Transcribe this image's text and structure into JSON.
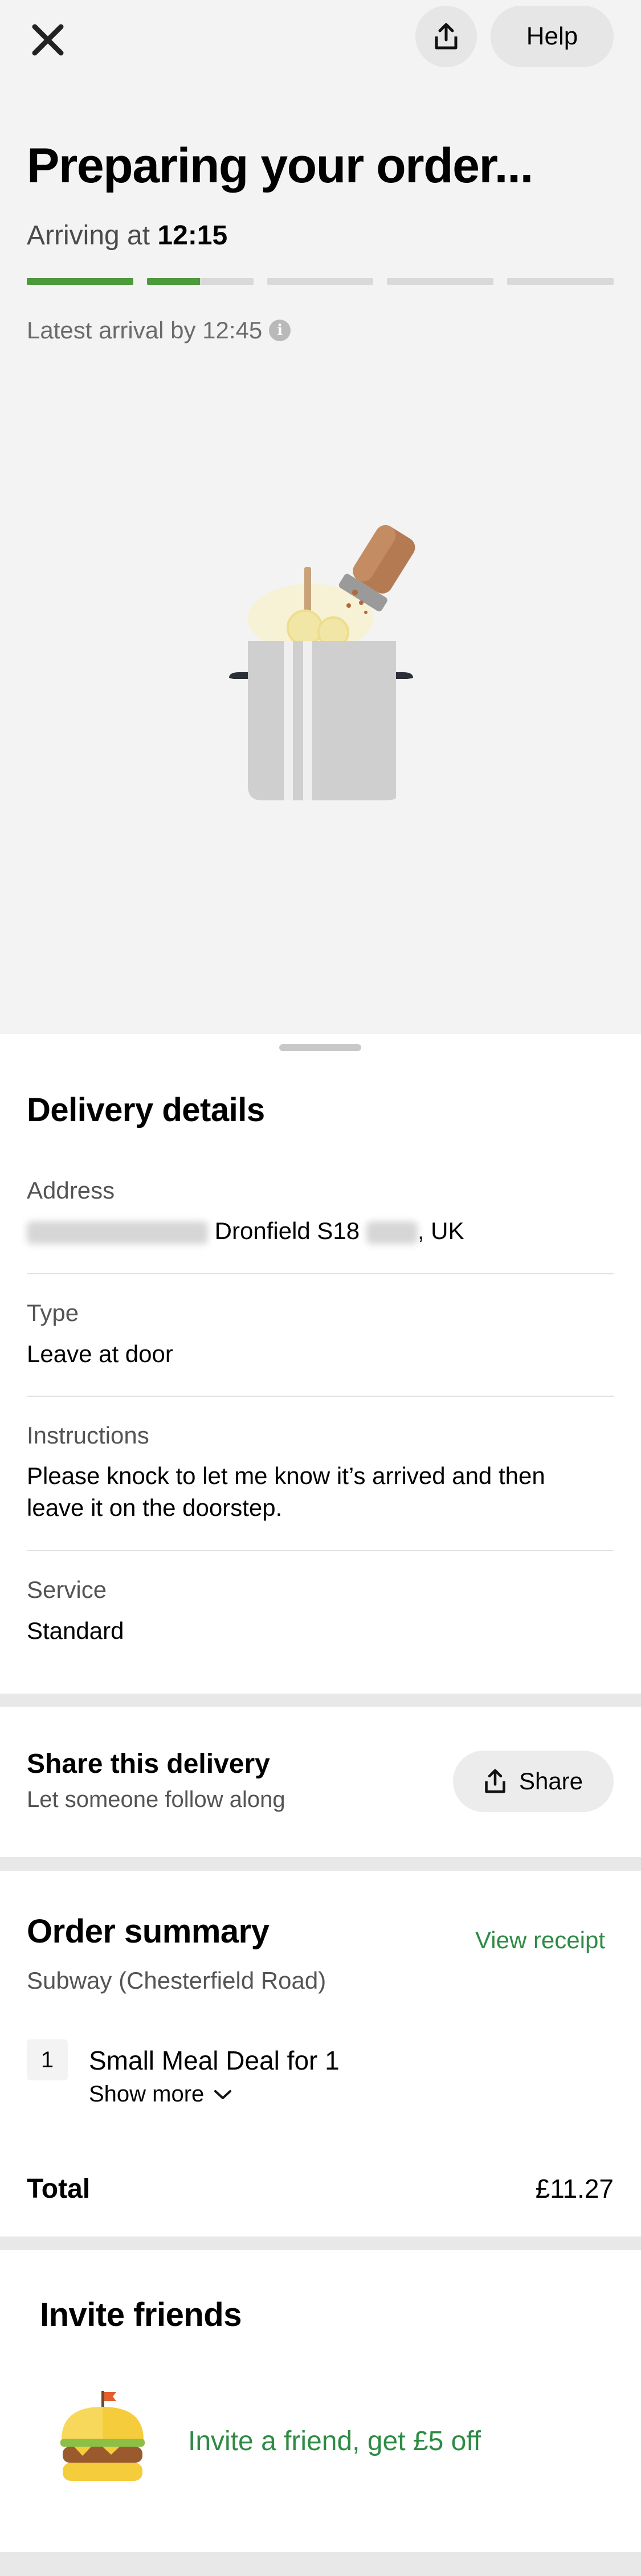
{
  "header": {
    "close_icon": "close-icon",
    "share_icon": "share-icon",
    "help_label": "Help"
  },
  "status": {
    "title": "Preparing your order...",
    "arriving_prefix": "Arriving at",
    "arriving_time": "12:15",
    "latest_arrival": "Latest arrival by 12:45",
    "info_icon": "info-icon",
    "progress_segments": [
      1,
      0.5,
      0,
      0,
      0
    ],
    "progress_color": "#4c9a3a",
    "illustration": "pot-with-salt-shaker-illustration"
  },
  "delivery": {
    "title": "Delivery details",
    "address_label": "Address",
    "address_visible": "Dronfield S18",
    "address_suffix": ", UK",
    "type_label": "Type",
    "type_value": "Leave at door",
    "instructions_label": "Instructions",
    "instructions_value": "Please knock to let me know it’s arrived and then leave it on the doorstep.",
    "service_label": "Service",
    "service_value": "Standard"
  },
  "share": {
    "title": "Share this delivery",
    "subtitle": "Let someone follow along",
    "button_label": "Share"
  },
  "order": {
    "title": "Order summary",
    "view_receipt": "View receipt",
    "restaurant": "Subway (Chesterfield Road)",
    "items": [
      {
        "qty": "1",
        "name": "Small Meal Deal for 1",
        "show_more": "Show more"
      }
    ],
    "total_label": "Total",
    "total_value": "£11.27"
  },
  "invite": {
    "title": "Invite friends",
    "link": "Invite a friend, get £5 off",
    "icon": "burger-icon"
  },
  "colors": {
    "accent_green": "#2e8b44",
    "progress_green": "#4c9a3a"
  }
}
